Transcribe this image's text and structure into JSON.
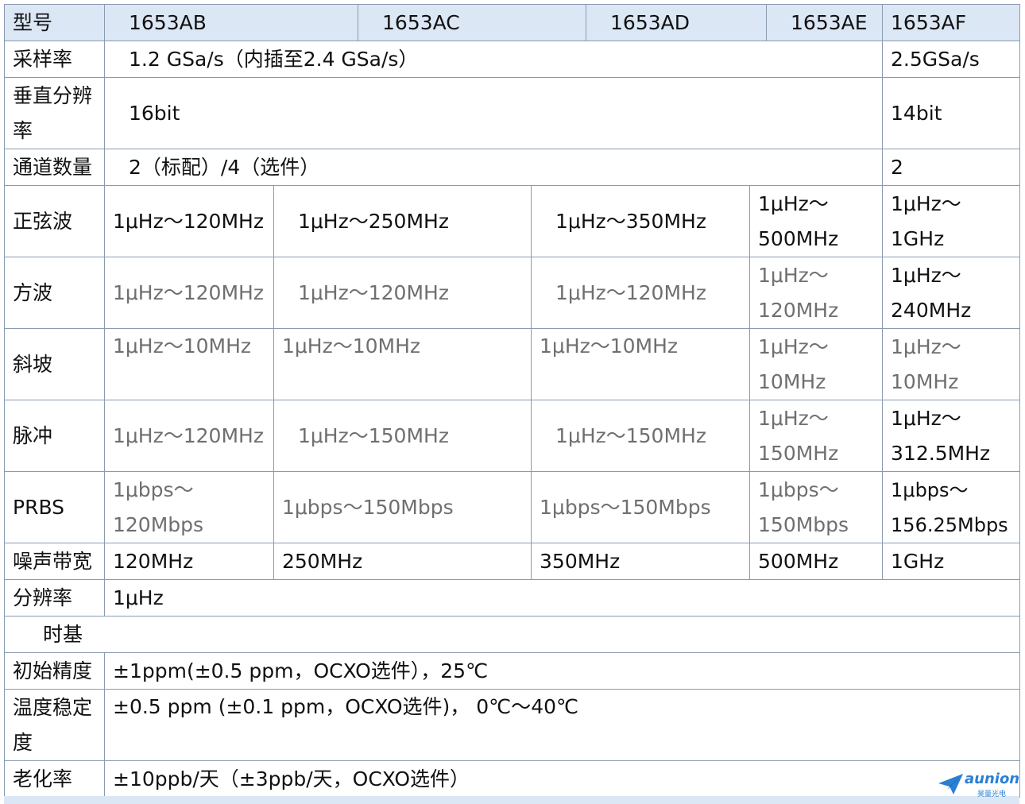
{
  "header": {
    "label": "型号",
    "models": [
      "1653AB",
      "1653AC",
      "1653AD",
      "1653AE",
      "1653AF"
    ]
  },
  "rows": {
    "sample_rate": {
      "label": "采样率",
      "main": "1.2 GSa/s（内插至2.4 GSa/s）",
      "af": "2.5GSa/s"
    },
    "vertical_res": {
      "label": "垂直分辨率",
      "main": "16bit",
      "af": "14bit"
    },
    "channels": {
      "label": "通道数量",
      "main": "2（标配）/4（选件）",
      "af": "2"
    },
    "sine": {
      "label": "正弦波",
      "values": [
        "1μHz～120MHz",
        "1μHz～250MHz",
        "1μHz～350MHz",
        "1μHz～500MHz",
        "1μHz～1GHz"
      ]
    },
    "square": {
      "label": "方波",
      "values": [
        "1μHz～120MHz",
        "1μHz～120MHz",
        "1μHz～120MHz",
        "1μHz～120MHz",
        "1μHz～240MHz"
      ]
    },
    "ramp": {
      "label": "斜坡",
      "values": [
        "1μHz～10MHz",
        "1μHz～10MHz",
        "1μHz～10MHz",
        "1μHz～10MHz",
        "1μHz～10MHz"
      ]
    },
    "pulse": {
      "label": "脉冲",
      "values": [
        "1μHz～120MHz",
        "1μHz～150MHz",
        "1μHz～150MHz",
        "1μHz～150MHz",
        "1μHz～312.5MHz"
      ]
    },
    "prbs": {
      "label": "PRBS",
      "values": [
        "1μbps～120Mbps",
        "1μbps～150Mbps",
        "1μbps～150Mbps",
        "1μbps～150Mbps",
        "1μbps～156.25Mbps"
      ]
    },
    "noise_bw": {
      "label": "噪声带宽",
      "values": [
        "120MHz",
        "250MHz",
        "350MHz",
        "500MHz",
        "1GHz"
      ]
    },
    "resolution": {
      "label": "分辨率",
      "value": "1μHz"
    },
    "timebase": {
      "label": "时基"
    },
    "initial_accuracy": {
      "label": "初始精度",
      "value": "±1ppm(±0.5 ppm，OCXO选件），25℃"
    },
    "temp_stability": {
      "label": "温度稳定度",
      "value": "±0.5 ppm (±0.1 ppm，OCXO选件)， 0℃～40℃"
    },
    "aging": {
      "label": "老化率",
      "value": "±10ppb/天（±3ppb/天，OCXO选件）"
    }
  },
  "watermark": {
    "brand": "aunion",
    "sub": "昊量光电"
  }
}
